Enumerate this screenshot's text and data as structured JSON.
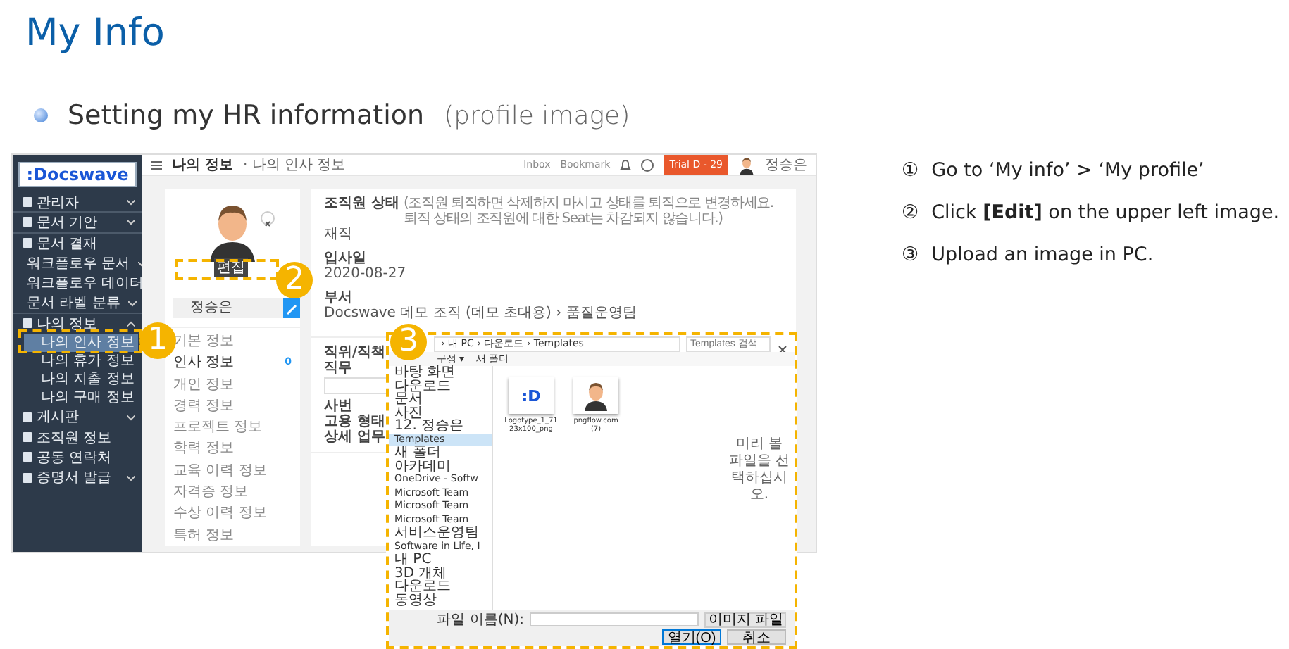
{
  "title": "My Info",
  "subtitle": {
    "main": "Setting my HR information",
    "note": "(profile image)"
  },
  "app": {
    "logo": ":Docswave",
    "sidebar": [
      {
        "label": "관리자",
        "expanded": false
      },
      {
        "label": "문서 기안",
        "expanded": false
      },
      {
        "label": "문서 결재"
      },
      {
        "label": "워크플로우 문서",
        "expanded": false
      },
      {
        "label": "워크플로우 데이터"
      },
      {
        "label": "문서 라벨 분류",
        "expanded": false
      },
      {
        "label": "나의 정보",
        "expanded": true,
        "children": [
          {
            "label": "나의 인사 정보",
            "selected": true
          },
          {
            "label": "나의 휴가 정보",
            "selected": false
          },
          {
            "label": "나의 지출 정보",
            "selected": false
          },
          {
            "label": "나의 구매 정보",
            "selected": false
          }
        ]
      },
      {
        "label": "게시판",
        "expanded": false
      },
      {
        "label": "조직원 정보"
      },
      {
        "label": "공동 연락처"
      },
      {
        "label": "증명서 발급",
        "expanded": false
      }
    ],
    "breadcrumb": {
      "page": "나의 정보",
      "sub": "· 나의 인사 정보"
    },
    "top_links": [
      "Inbox",
      "Bookmark"
    ],
    "trial_badge": "Trial D - 29",
    "user_name": "정승은",
    "profile": {
      "edit_label": "편집",
      "name": "정승은",
      "menu": [
        {
          "label": "기본 정보",
          "selected": false
        },
        {
          "label": "인사 정보",
          "selected": true,
          "badge": "0"
        },
        {
          "label": "개인 정보",
          "selected": false
        },
        {
          "label": "경력 정보",
          "selected": false
        },
        {
          "label": "프로젝트 정보",
          "selected": false
        },
        {
          "label": "학력 정보",
          "selected": false
        },
        {
          "label": "교육 이력 정보",
          "selected": false
        },
        {
          "label": "자격증 정보",
          "selected": false
        },
        {
          "label": "수상 이력 정보",
          "selected": false
        },
        {
          "label": "특허 정보",
          "selected": false
        }
      ]
    },
    "details": [
      {
        "label": "조직원 상태",
        "hint": "(조직원 퇴직하면 삭제하지 마시고 상태를 퇴직으로 변경하세요. 퇴직 상태의 조직원에 대한 Seat는 차감되지 않습니다.)",
        "value": "재직"
      },
      {
        "label": "입사일",
        "value": "2020-08-27"
      },
      {
        "label": "부서",
        "value": "Docswave 데모 조직 (데모 초대용) › 품질운영팀"
      }
    ],
    "fields": [
      {
        "label": "직위/직책",
        "kind": "label"
      },
      {
        "label": "직무",
        "kind": "input"
      },
      {
        "label": "사번",
        "kind": "label"
      },
      {
        "label": "고용 형태",
        "kind": "label"
      },
      {
        "label": "상세 업무",
        "kind": "label"
      }
    ]
  },
  "dialog": {
    "path": "› 내 PC › 다운로드 › Templates",
    "search_placeholder": "Templates 검색",
    "organize": "구성 ▾",
    "new_folder": "새 폴더",
    "tree": [
      {
        "label": "바탕 화면",
        "selected": false
      },
      {
        "label": "다운로드",
        "selected": false
      },
      {
        "label": "문서",
        "selected": false
      },
      {
        "label": "사진",
        "selected": false
      },
      {
        "label": "12. 정승은",
        "selected": false
      },
      {
        "label": "Templates",
        "selected": true
      },
      {
        "label": "새 폴더",
        "selected": false
      },
      {
        "label": "아카데미",
        "selected": false
      },
      {
        "label": "OneDrive - Softw",
        "selected": false
      },
      {
        "label": "Microsoft Team",
        "selected": false
      },
      {
        "label": "Microsoft Team",
        "selected": false
      },
      {
        "label": "Microsoft Team",
        "selected": false
      },
      {
        "label": "서비스운영팀",
        "selected": false
      },
      {
        "label": "Software in Life, I",
        "selected": false
      },
      {
        "label": "내 PC",
        "selected": false
      },
      {
        "label": "3D 개체",
        "selected": false
      },
      {
        "label": "다운로드",
        "selected": false
      },
      {
        "label": "동영상",
        "selected": false
      }
    ],
    "files": [
      {
        "name": "Logotype_1_7123x100_png",
        "kind": "logo",
        "mark": ":D"
      },
      {
        "name": "pngflow.com (7)",
        "kind": "person"
      }
    ],
    "preview_note": "미리 볼 파일을 선택하십시오.",
    "filename_label": "파일 이름(N):",
    "filter": "이미지 파일",
    "open": "열기(O)",
    "cancel": "취소"
  },
  "markers": [
    "1",
    "2",
    "3"
  ],
  "steps": [
    {
      "num": "①",
      "text": "Go to ‘My info’ > ‘My profile’"
    },
    {
      "num": "②",
      "text": "Click **[Edit]** on the upper left image."
    },
    {
      "num": "③",
      "text": "Upload an image in PC."
    }
  ]
}
